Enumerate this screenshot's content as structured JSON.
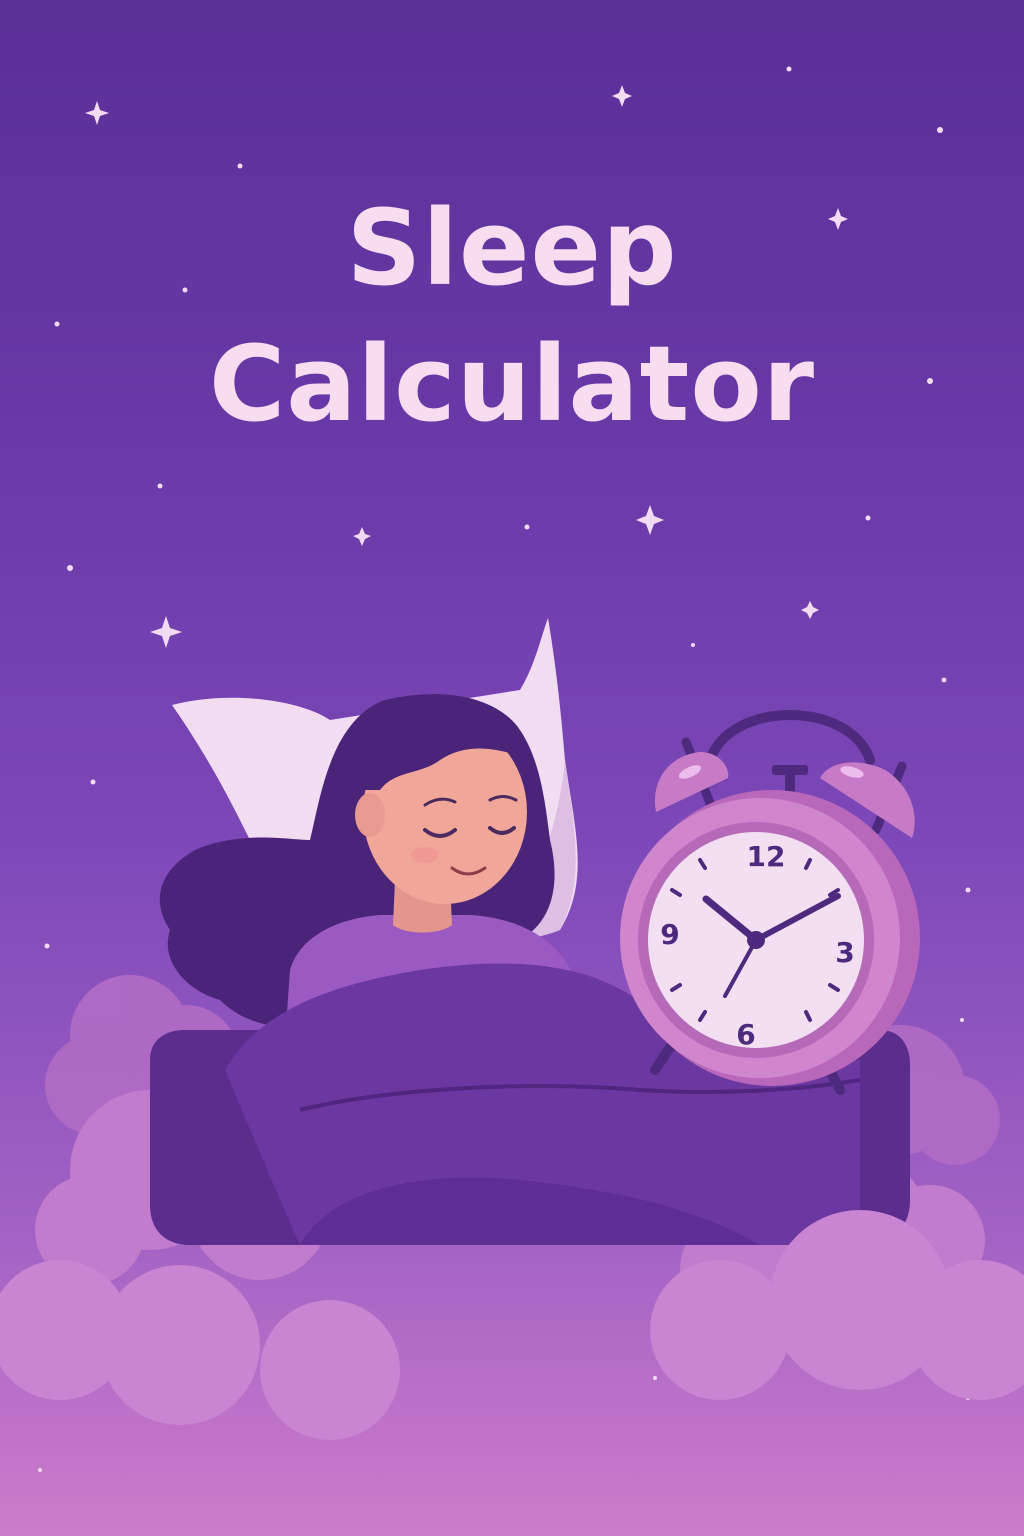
{
  "title": {
    "line1": "Sleep",
    "line2": "Calculator"
  },
  "clock": {
    "numerals": {
      "n12": "12",
      "n3": "3",
      "n6": "6",
      "n9": "9"
    },
    "time_shown": "10:10"
  },
  "colors": {
    "title_text": "#f8dcf0",
    "clock_body": "#c77bc6",
    "clock_face": "#f3dff2",
    "clock_hands": "#4d2a7e"
  },
  "icons": [
    "sparkle-star-icon",
    "alarm-clock-icon",
    "pillow-icon",
    "cloud-icon"
  ]
}
